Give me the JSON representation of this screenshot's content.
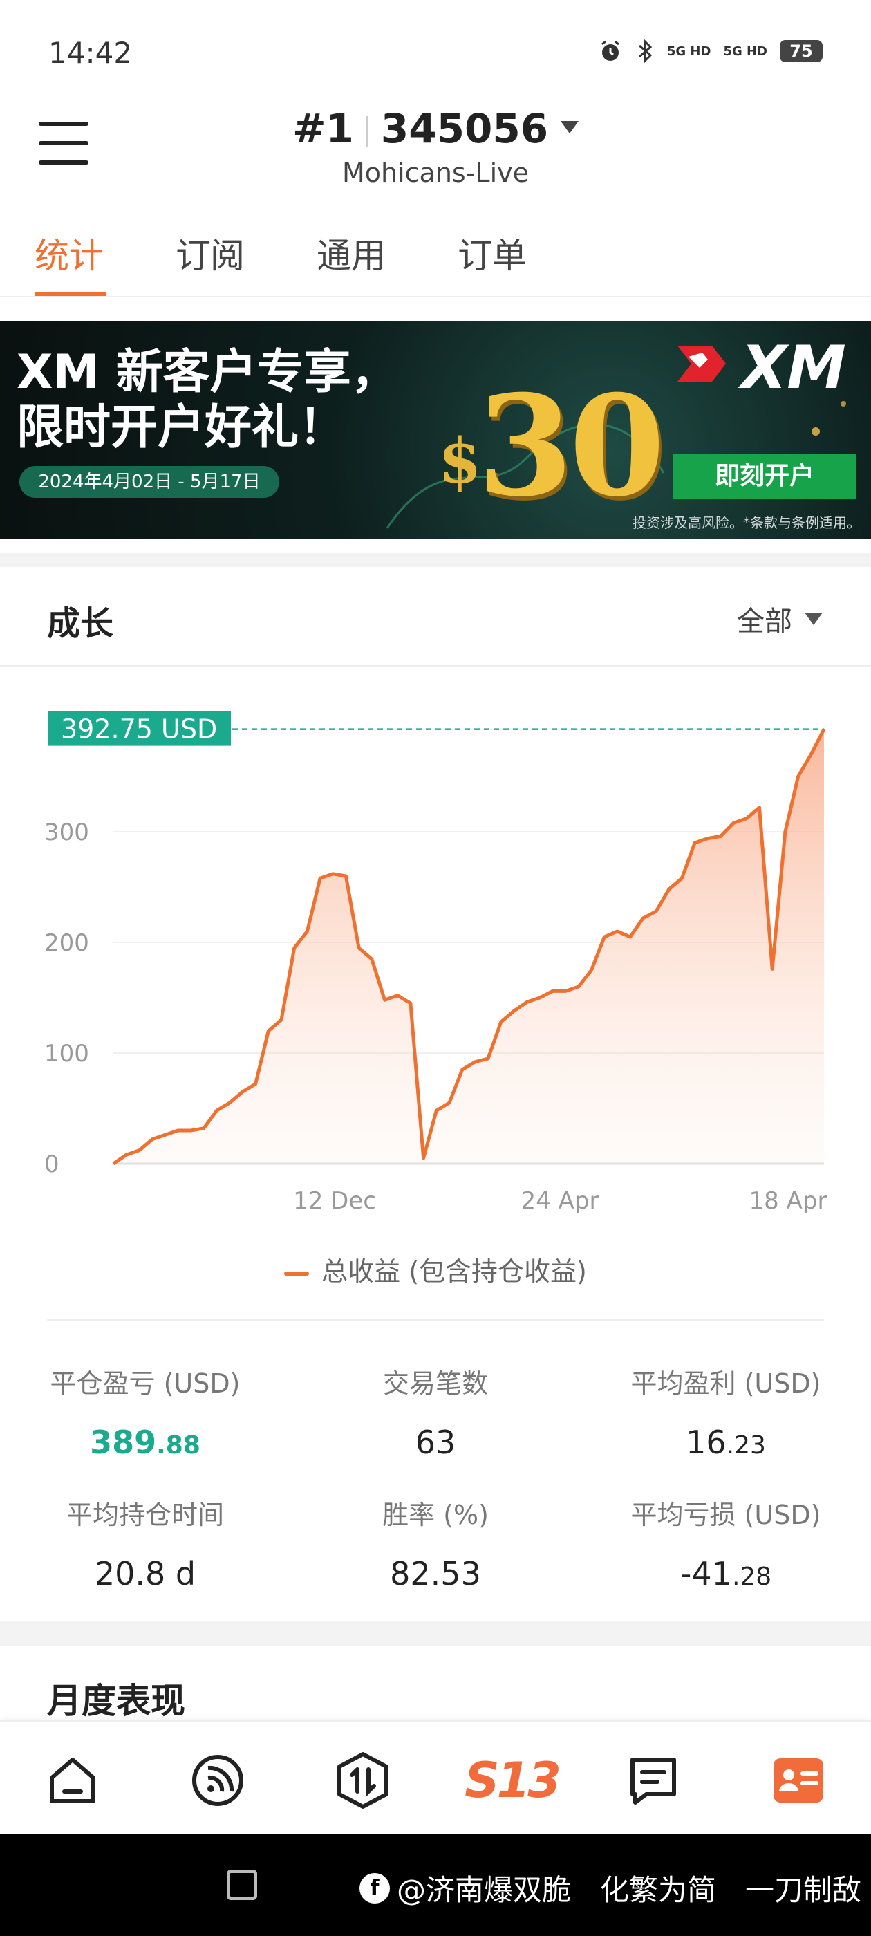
{
  "status_bar": {
    "time": "14:42",
    "network1": "5G HD",
    "network2": "5G HD",
    "battery": "75"
  },
  "header": {
    "account_prefix": "#1",
    "account_number": "345056",
    "server": "Mohicans-Live"
  },
  "tabs": [
    {
      "label": "统计",
      "active": true
    },
    {
      "label": "订阅",
      "active": false
    },
    {
      "label": "通用",
      "active": false
    },
    {
      "label": "订单",
      "active": false
    }
  ],
  "banner": {
    "line1": "XM 新客户专享，",
    "line2": "限时开户好礼！",
    "date_range": "2024年4月02日 - 5月17日",
    "currency_symbol": "$",
    "amount": "30",
    "brand": "XM",
    "cta": "即刻开户",
    "disclaimer": "投资涉及高风险。*条款与条例适用。"
  },
  "growth": {
    "title": "成长",
    "filter": "全部",
    "current_value_label": "392.75 USD",
    "legend": "总收益 (包含持仓收益)"
  },
  "chart_data": {
    "type": "area",
    "color": "#f07030",
    "y_ticks": [
      "0",
      "100",
      "200",
      "300"
    ],
    "x_tick_labels": [
      "12 Dec",
      "24 Apr",
      "18 Apr"
    ],
    "ylim": [
      0,
      400
    ],
    "current_value": 392.75,
    "values": [
      0,
      8,
      12,
      22,
      26,
      30,
      30,
      32,
      48,
      55,
      65,
      72,
      120,
      130,
      195,
      210,
      258,
      262,
      260,
      195,
      185,
      148,
      152,
      145,
      5,
      48,
      55,
      85,
      92,
      95,
      128,
      138,
      146,
      150,
      156,
      156,
      160,
      175,
      205,
      210,
      205,
      222,
      228,
      248,
      258,
      290,
      294,
      296,
      308,
      312,
      322,
      176,
      300,
      350,
      370,
      392.75
    ]
  },
  "stats": [
    {
      "label": "平仓盈亏 (USD)",
      "int": "389",
      "frac": ".88",
      "highlight": true
    },
    {
      "label": "交易笔数",
      "int": "63",
      "frac": "",
      "highlight": false
    },
    {
      "label": "平均盈利 (USD)",
      "int": "16",
      "frac": ".23",
      "highlight": false
    },
    {
      "label": "平均持仓时间",
      "int": "20.8 d",
      "frac": "",
      "highlight": false
    },
    {
      "label": "胜率 (%)",
      "int": "82.53",
      "frac": "",
      "highlight": false
    },
    {
      "label": "平均亏损 (USD)",
      "int": "-41",
      "frac": ".28",
      "highlight": false
    }
  ],
  "monthly": {
    "title": "月度表现"
  },
  "bottom_nav": [
    {
      "icon": "home-icon"
    },
    {
      "icon": "feed-icon"
    },
    {
      "icon": "trade-icon"
    },
    {
      "icon": "s13-logo",
      "label": "S13"
    },
    {
      "icon": "message-icon"
    },
    {
      "icon": "profile-card-icon"
    }
  ],
  "watermark": "@济南爆双脆　化繁为简　一刀制敌"
}
